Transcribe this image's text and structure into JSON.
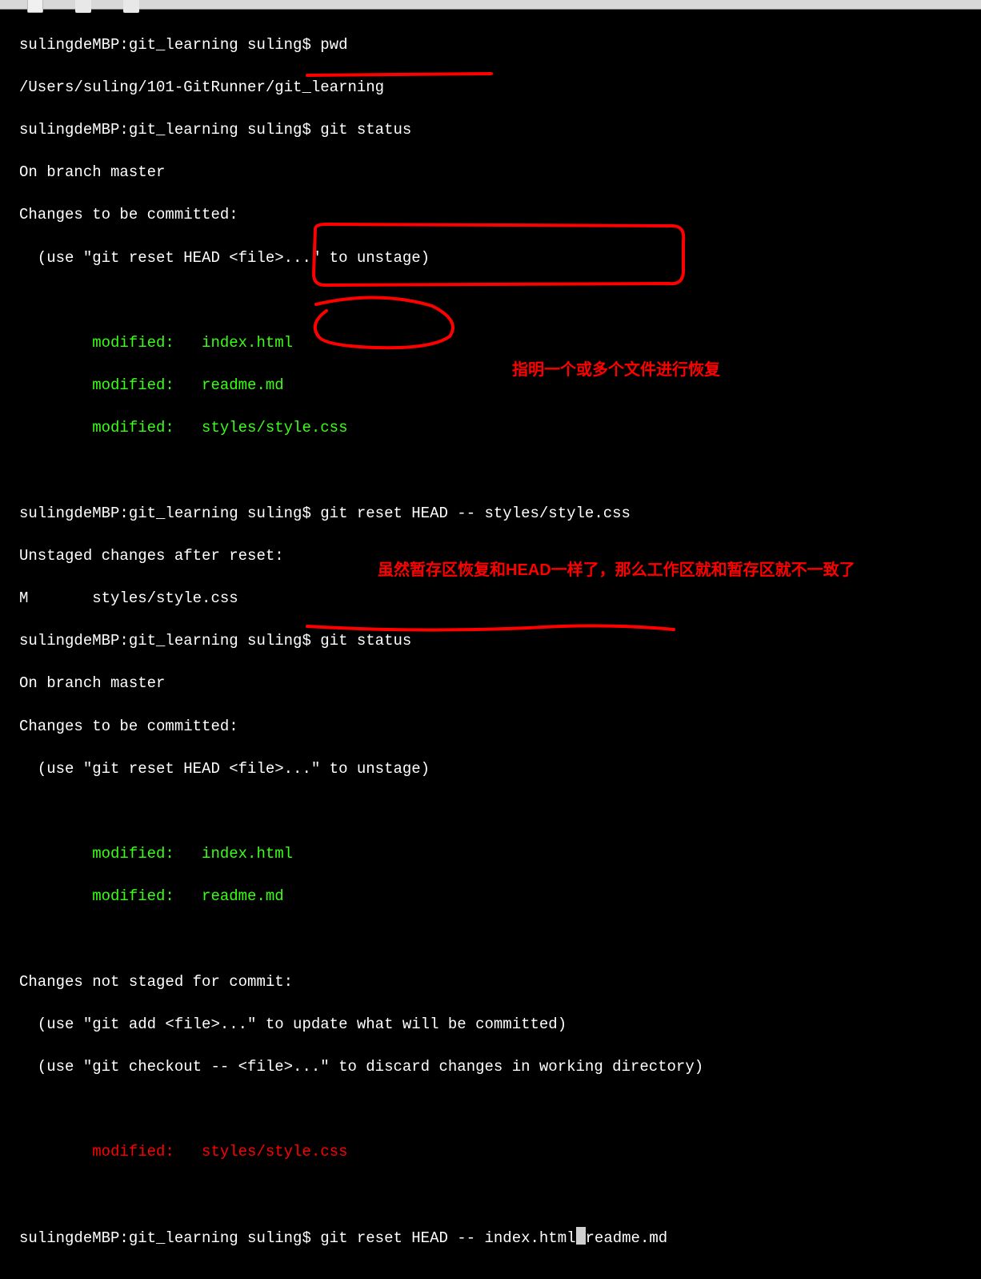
{
  "prompt": "sulingdeMBP:git_learning suling$ ",
  "cmd": {
    "pwd": "pwd",
    "pwd_out": "/Users/suling/101-GitRunner/git_learning",
    "status": "git status",
    "reset_css": "git reset HEAD -- styles/style.css",
    "reset_multi": "git reset HEAD -- index.html readme.md"
  },
  "status": {
    "branch": "On branch master",
    "to_commit": "Changes to be committed:",
    "unstage_hint": "  (use \"git reset HEAD <file>...\" to unstage)",
    "not_staged": "Changes not staged for commit:",
    "add_hint": "  (use \"git add <file>...\" to update what will be committed)",
    "checkout_hint": "  (use \"git checkout -- <file>...\" to discard changes in working directory)"
  },
  "reset_out": {
    "l1": "Unstaged changes after reset:",
    "l2": "M       styles/style.css"
  },
  "mod": {
    "idx": "        modified:   index.html",
    "rdm": "        modified:   readme.md",
    "css": "        modified:   styles/style.css"
  },
  "annot": {
    "a1": "指明一个或多个文件进行恢复",
    "a2": "虽然暂存区恢复和HEAD一样了，那么工作区就和暂存区就不一致了"
  }
}
